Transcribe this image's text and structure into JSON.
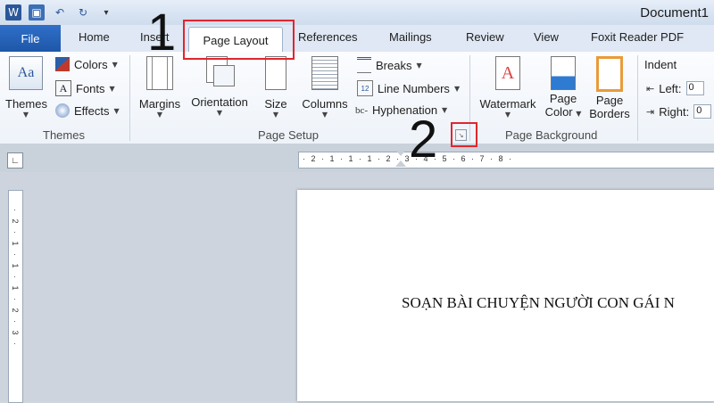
{
  "window": {
    "title": "Document1"
  },
  "tabs": [
    "File",
    "Home",
    "Insert",
    "Page Layout",
    "References",
    "Mailings",
    "Review",
    "View",
    "Foxit Reader PDF"
  ],
  "ribbon": {
    "themes_group": {
      "label": "Themes",
      "themes_btn": "Themes",
      "colors": "Colors",
      "fonts": "Fonts",
      "effects": "Effects"
    },
    "page_setup": {
      "label": "Page Setup",
      "margins": "Margins",
      "orientation": "Orientation",
      "size": "Size",
      "columns": "Columns",
      "breaks": "Breaks",
      "line_numbers": "Line Numbers",
      "hyphenation": "Hyphenation"
    },
    "page_background": {
      "label": "Page Background",
      "watermark": "Watermark",
      "page_color_1": "Page",
      "page_color_2": "Color",
      "page_borders_1": "Page",
      "page_borders_2": "Borders"
    },
    "paragraph": {
      "indent": "Indent",
      "left": "Left:",
      "right": "Right:",
      "left_val": "0",
      "right_val": "0"
    }
  },
  "ruler": {
    "marks": "· 2 · 1 · 1 · 1 · 2 · 3 · 4 · 5 · 6 · 7 · 8 ·"
  },
  "vruler": {
    "marks": "· 2 · 1 · 1 · 1 · 2 · 3 ·"
  },
  "document": {
    "text": "SOẠN BÀI CHUYỆN NGƯỜI CON GÁI N"
  },
  "annotations": {
    "one": "1",
    "two": "2"
  },
  "colors": {
    "accent": "#2b579a",
    "annotation": "#e0262d"
  }
}
